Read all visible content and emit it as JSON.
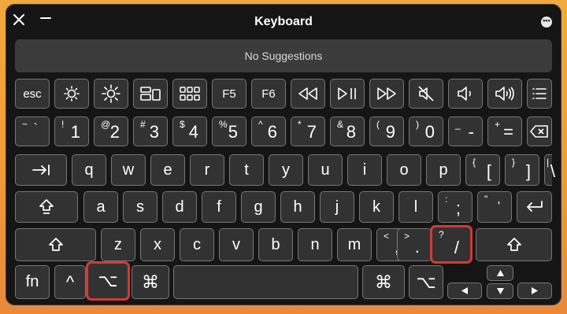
{
  "window": {
    "title": "Keyboard"
  },
  "suggestions": {
    "text": "No Suggestions"
  },
  "colors": {
    "background": "#151515",
    "key": "#323232",
    "key_border": "#767676",
    "highlight": "#d23b35",
    "wallpaper": "#ef9a3a"
  },
  "rows": {
    "function": [
      {
        "label": "esc"
      },
      {
        "icon": "brightness-down-icon"
      },
      {
        "icon": "brightness-up-icon"
      },
      {
        "icon": "mission-control-icon"
      },
      {
        "icon": "launchpad-icon"
      },
      {
        "label": "F5"
      },
      {
        "label": "F6"
      },
      {
        "icon": "rewind-icon"
      },
      {
        "icon": "play-pause-icon"
      },
      {
        "icon": "fast-forward-icon"
      },
      {
        "icon": "mute-icon"
      },
      {
        "icon": "volume-down-icon"
      },
      {
        "icon": "volume-up-icon"
      },
      {
        "icon": "list-icon"
      }
    ],
    "number": [
      {
        "sec": "~",
        "pri": "`"
      },
      {
        "sec": "!",
        "pri": "1"
      },
      {
        "sec": "@",
        "pri": "2"
      },
      {
        "sec": "#",
        "pri": "3"
      },
      {
        "sec": "$",
        "pri": "4"
      },
      {
        "sec": "%",
        "pri": "5"
      },
      {
        "sec": "^",
        "pri": "6"
      },
      {
        "sec": "*",
        "pri": "8"
      },
      {
        "sec": "&",
        "pri": "7"
      },
      {
        "sec": "(",
        "pri": "9"
      },
      {
        "sec": ")",
        "pri": "0"
      },
      {
        "sec": "_",
        "pri": "-"
      },
      {
        "sec": "+",
        "pri": "="
      },
      {
        "icon": "delete-icon"
      }
    ],
    "qwerty": [
      {
        "icon": "tab-icon"
      },
      {
        "label": "q"
      },
      {
        "label": "w"
      },
      {
        "label": "e"
      },
      {
        "label": "r"
      },
      {
        "label": "t"
      },
      {
        "label": "y"
      },
      {
        "label": "u"
      },
      {
        "label": "i"
      },
      {
        "label": "o"
      },
      {
        "label": "p"
      },
      {
        "sec": "{",
        "pri": "["
      },
      {
        "sec": "}",
        "pri": "]"
      },
      {
        "sec": "|",
        "pri": "\\"
      }
    ],
    "home": [
      {
        "icon": "caps-lock-icon"
      },
      {
        "label": "a"
      },
      {
        "label": "s"
      },
      {
        "label": "d"
      },
      {
        "label": "f"
      },
      {
        "label": "g"
      },
      {
        "label": "h"
      },
      {
        "label": "j"
      },
      {
        "label": "k"
      },
      {
        "label": "l"
      },
      {
        "sec": ":",
        "pri": ";"
      },
      {
        "sec": "\"",
        "pri": "'"
      },
      {
        "icon": "return-icon"
      }
    ],
    "shift": [
      {
        "icon": "shift-icon"
      },
      {
        "label": "z"
      },
      {
        "label": "x"
      },
      {
        "label": "c"
      },
      {
        "label": "v"
      },
      {
        "label": "b"
      },
      {
        "label": "n"
      },
      {
        "label": "m"
      },
      {
        "sec": "<",
        "pri": ","
      },
      {
        "sec": ">",
        "pri": "."
      },
      {
        "sec": "?",
        "pri": "/"
      },
      {
        "icon": "shift-icon"
      }
    ],
    "bottom": [
      {
        "label": "fn"
      },
      {
        "label": "^"
      },
      {
        "label": "⌥"
      },
      {
        "label": "⌘"
      },
      {
        "label": ""
      },
      {
        "label": "⌘"
      },
      {
        "label": "⌥"
      }
    ]
  }
}
